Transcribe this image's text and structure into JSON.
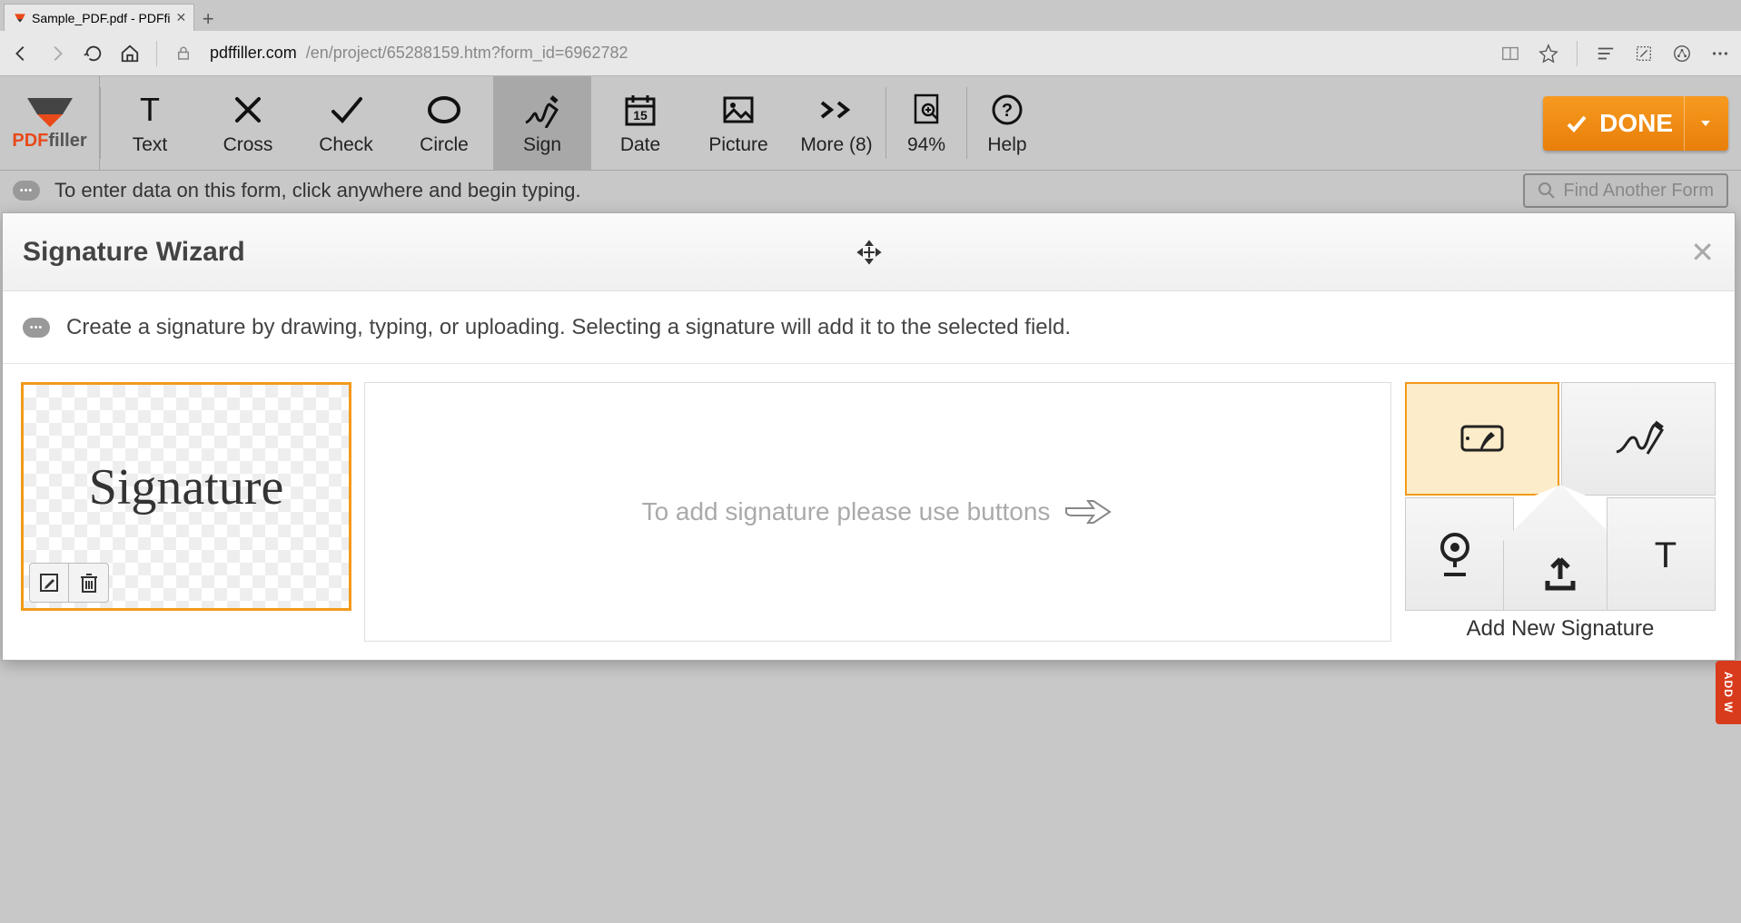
{
  "browser": {
    "tab_title": "Sample_PDF.pdf - PDFfi",
    "url_host": "pdffiller.com",
    "url_path": "/en/project/65288159.htm?form_id=6962782"
  },
  "app": {
    "brand_a": "PDF",
    "brand_b": "filler",
    "tools": {
      "text": "Text",
      "cross": "Cross",
      "check": "Check",
      "circle": "Circle",
      "sign": "Sign",
      "date": "Date",
      "picture": "Picture",
      "more": "More (8)"
    },
    "zoom": "94%",
    "help": "Help",
    "done": "DONE",
    "date_day": "15"
  },
  "hint": {
    "top": "To enter data on this form, click anywhere and begin typing.",
    "find_form": "Find Another Form"
  },
  "dialog": {
    "title": "Signature Wizard",
    "hint": "Create a signature by drawing, typing, or uploading. Selecting a signature will add it to the selected field.",
    "existing_text": "Signature",
    "placeholder": "To add signature please use buttons",
    "add_new": "Add New Signature"
  },
  "side_tab": "ADD W"
}
